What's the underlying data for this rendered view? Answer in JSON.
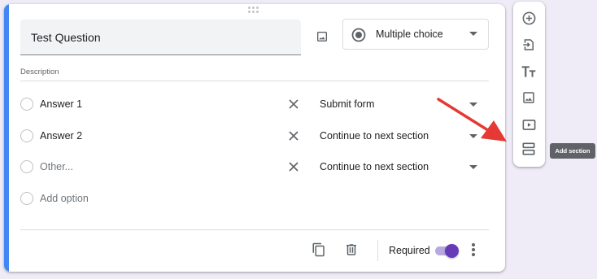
{
  "question": {
    "title": "Test Question",
    "type_label": "Multiple choice",
    "description_placeholder": "Description"
  },
  "options": [
    {
      "label": "Answer 1",
      "goto": "Submit form",
      "muted": false
    },
    {
      "label": "Answer 2",
      "goto": "Continue to next section",
      "muted": false
    },
    {
      "label": "Other...",
      "goto": "Continue to next section",
      "muted": true
    }
  ],
  "add_option_label": "Add option",
  "footer": {
    "required_label": "Required",
    "required_on": true
  },
  "toolbar": {
    "items": [
      "add-question",
      "import-questions",
      "add-title-description",
      "add-image",
      "add-video",
      "add-section"
    ],
    "tooltip": "Add section"
  },
  "colors": {
    "accent": "#4285f4",
    "toggle": "#673ab7",
    "arrow": "#e53935",
    "background": "#efebf7"
  }
}
